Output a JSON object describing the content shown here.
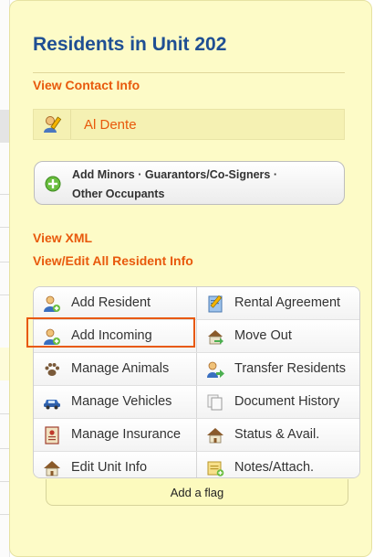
{
  "panel": {
    "title": "Residents in Unit 202",
    "view_contact_info": "View Contact Info",
    "resident_name": "Al Dente",
    "add_minors_line1": "Add Minors · Guarantors/Co-Signers ·",
    "add_minors_line2": "Other Occupants",
    "view_xml": "View XML",
    "view_edit_all": "View/Edit All Resident Info",
    "add_flag": "Add a flag"
  },
  "actions": [
    {
      "label": "Add Resident",
      "icon": "add-resident-icon"
    },
    {
      "label": "Rental Agreement",
      "icon": "rental-agreement-icon"
    },
    {
      "label": "Add Incoming",
      "icon": "add-incoming-icon"
    },
    {
      "label": "Move Out",
      "icon": "move-out-icon"
    },
    {
      "label": "Manage Animals",
      "icon": "paw-icon"
    },
    {
      "label": "Transfer Residents",
      "icon": "transfer-residents-icon"
    },
    {
      "label": "Manage Vehicles",
      "icon": "car-icon"
    },
    {
      "label": "Document History",
      "icon": "document-history-icon"
    },
    {
      "label": "Manage Insurance",
      "icon": "insurance-icon"
    },
    {
      "label": "Status & Avail.",
      "icon": "house-icon"
    },
    {
      "label": "Edit Unit Info",
      "icon": "edit-house-icon"
    },
    {
      "label": "Notes/Attach.",
      "icon": "notes-icon"
    }
  ],
  "colors": {
    "title": "#1f4f93",
    "link": "#e8590c",
    "panel_bg": "#fdfbc7",
    "highlight": "#e8590c"
  }
}
